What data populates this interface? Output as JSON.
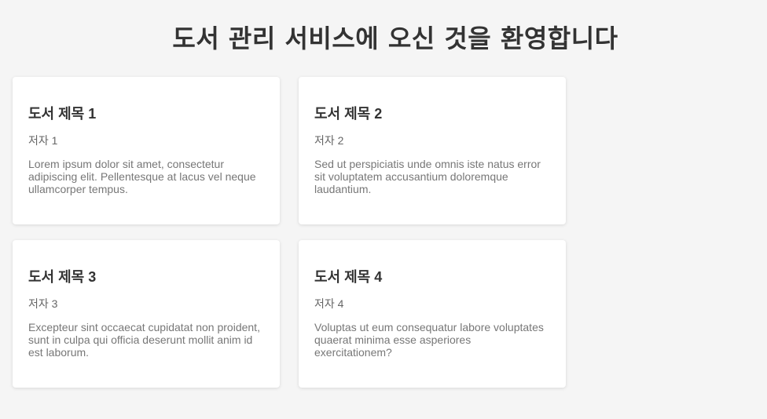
{
  "header": {
    "title": "도서 관리 서비스에 오신 것을 환영합니다"
  },
  "books": [
    {
      "title": "도서 제목 1",
      "author": "저자 1",
      "description": "Lorem ipsum dolor sit amet, consectetur adipiscing elit. Pellentesque at lacus vel neque ullamcorper tempus."
    },
    {
      "title": "도서 제목 2",
      "author": "저자 2",
      "description": "Sed ut perspiciatis unde omnis iste natus error sit voluptatem accusantium doloremque laudantium."
    },
    {
      "title": "도서 제목 3",
      "author": "저자 3",
      "description": "Excepteur sint occaecat cupidatat non proident, sunt in culpa qui officia deserunt mollit anim id est laborum."
    },
    {
      "title": "도서 제목 4",
      "author": "저자 4",
      "description": "Voluptas ut eum consequatur labore voluptates quaerat minima esse asperiores exercitationem?"
    }
  ],
  "colors": {
    "background": "#f5f5f5",
    "card": "#ffffff",
    "title_text": "#333333",
    "author_text": "#666666",
    "description_text": "#777777"
  }
}
